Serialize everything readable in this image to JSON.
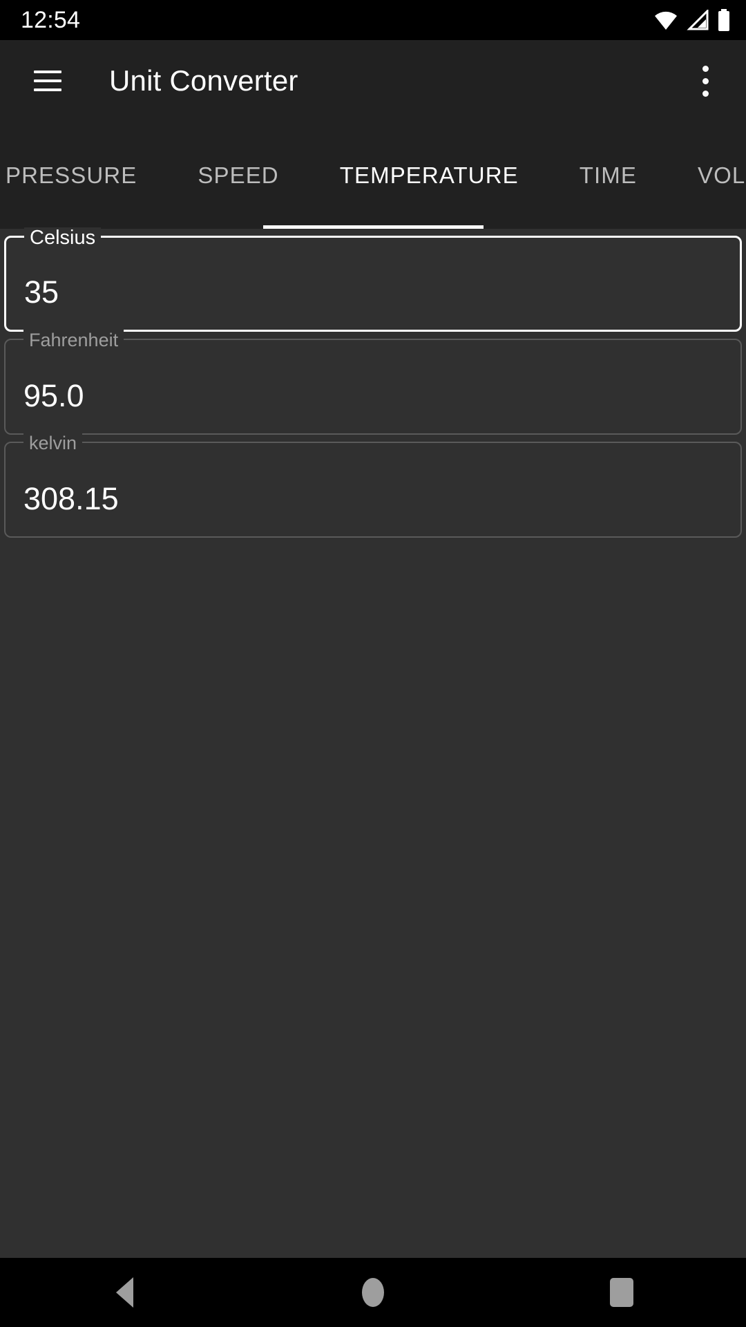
{
  "status_bar": {
    "time": "12:54",
    "icons": [
      "wifi-icon",
      "cell-signal-icon",
      "battery-icon"
    ]
  },
  "app_bar": {
    "menu_icon": "hamburger-menu-icon",
    "title": "Unit Converter",
    "overflow_icon": "more-vert-icon"
  },
  "tabs": {
    "items": [
      {
        "label": "PRESSURE",
        "active": false
      },
      {
        "label": "SPEED",
        "active": false
      },
      {
        "label": "TEMPERATURE",
        "active": true
      },
      {
        "label": "TIME",
        "active": false
      },
      {
        "label": "VOLUME",
        "active": false
      }
    ],
    "selected": "TEMPERATURE",
    "indicator_color": "#ffffff"
  },
  "fields": [
    {
      "label": "Celsius",
      "value": "35",
      "focused": true,
      "name": "celsius-field"
    },
    {
      "label": "Fahrenheit",
      "value": "95.0",
      "focused": false,
      "name": "fahrenheit-field"
    },
    {
      "label": "kelvin",
      "value": "308.15",
      "focused": false,
      "name": "kelvin-field"
    }
  ],
  "nav_bar": {
    "back": "back-nav-icon",
    "home": "home-nav-icon",
    "recents": "recents-nav-icon"
  },
  "colors": {
    "app_bar_bg": "#212121",
    "content_bg": "#303030",
    "accent": "#ffffff",
    "inactive_tab": "#bdbdbd",
    "field_border": "#5a5a5a",
    "label_muted": "#9e9e9e"
  }
}
